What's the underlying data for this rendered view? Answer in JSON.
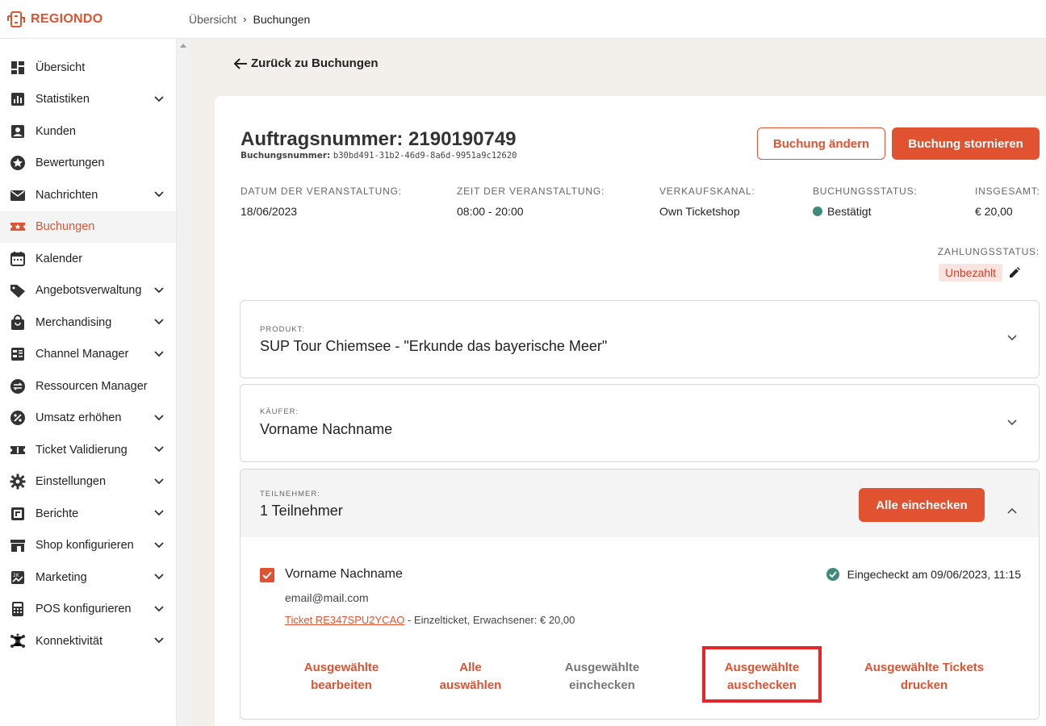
{
  "brand": {
    "name": "REGIONDO",
    "accent": "#e05230"
  },
  "breadcrumb": {
    "items": [
      "Übersicht",
      "Buchungen"
    ],
    "separator": "›"
  },
  "sidebar": {
    "items": [
      {
        "label": "Übersicht",
        "icon": "dashboard-icon",
        "expandable": false,
        "active": false
      },
      {
        "label": "Statistiken",
        "icon": "bar-chart-icon",
        "expandable": true,
        "active": false
      },
      {
        "label": "Kunden",
        "icon": "person-icon",
        "expandable": false,
        "active": false
      },
      {
        "label": "Bewertungen",
        "icon": "star-icon",
        "expandable": false,
        "active": false
      },
      {
        "label": "Nachrichten",
        "icon": "mail-icon",
        "expandable": true,
        "active": false
      },
      {
        "label": "Buchungen",
        "icon": "ticket-icon",
        "expandable": false,
        "active": true
      },
      {
        "label": "Kalender",
        "icon": "calendar-icon",
        "expandable": false,
        "active": false
      },
      {
        "label": "Angebotsverwaltung",
        "icon": "tag-icon",
        "expandable": true,
        "active": false
      },
      {
        "label": "Merchandising",
        "icon": "shopping-bag-icon",
        "expandable": true,
        "active": false
      },
      {
        "label": "Channel Manager",
        "icon": "channel-icon",
        "expandable": true,
        "active": false
      },
      {
        "label": "Ressourcen Manager",
        "icon": "swap-icon",
        "expandable": false,
        "active": false
      },
      {
        "label": "Umsatz erhöhen",
        "icon": "percent-icon",
        "expandable": true,
        "active": false
      },
      {
        "label": "Ticket Validierung",
        "icon": "ticket-validation-icon",
        "expandable": true,
        "active": false
      },
      {
        "label": "Einstellungen",
        "icon": "gear-icon",
        "expandable": true,
        "active": false
      },
      {
        "label": "Berichte",
        "icon": "report-icon",
        "expandable": true,
        "active": false
      },
      {
        "label": "Shop konfigurieren",
        "icon": "store-icon",
        "expandable": true,
        "active": false
      },
      {
        "label": "Marketing",
        "icon": "marketing-icon",
        "expandable": true,
        "active": false
      },
      {
        "label": "POS konfigurieren",
        "icon": "calculator-icon",
        "expandable": true,
        "active": false
      },
      {
        "label": "Konnektivität",
        "icon": "network-icon",
        "expandable": true,
        "active": false
      }
    ]
  },
  "main": {
    "back_link": "Zurück zu Buchungen",
    "order": {
      "title_prefix": "Auftragsnummer:",
      "order_number": "2190190749",
      "booking_label": "Buchungsnummer:",
      "booking_number": "b30bd491-31b2-46d9-8a6d-9951a9c12620"
    },
    "buttons": {
      "change": "Buchung ändern",
      "cancel": "Buchung stornieren"
    },
    "meta": {
      "event_date_label": "DATUM DER VERANSTALTUNG:",
      "event_date": "18/06/2023",
      "event_time_label": "ZEIT DER VERANSTALTUNG:",
      "event_time": "08:00 - 20:00",
      "channel_label": "VERKAUFSKANAL:",
      "channel": "Own Ticketshop",
      "status_label": "BUCHUNGSSTATUS:",
      "status": "Bestätigt",
      "total_label": "INSGESAMT:",
      "total": "€ 20,00"
    },
    "payment": {
      "label": "ZAHLUNGSSTATUS:",
      "status": "Unbezahlt"
    },
    "product": {
      "label": "PRODUKT:",
      "value": "SUP Tour Chiemsee - \"Erkunde das bayerische Meer\""
    },
    "buyer": {
      "label": "KÄUFER:",
      "value": "Vorname Nachname"
    },
    "participants": {
      "label": "TEILNEHMER:",
      "value": "1 Teilnehmer",
      "checkin_all": "Alle einchecken",
      "person": {
        "name": "Vorname Nachname",
        "email": "email@mail.com",
        "ticket_link": "Ticket RE347SPU2YCAO",
        "ticket_details": " - Einzelticket, Erwachsener: € 20,00",
        "checked_in": "Eingecheckt am 09/06/2023, 11:15",
        "selected": true
      },
      "actions": {
        "edit_line1": "Ausgewählte",
        "edit_line2": "bearbeiten",
        "all_line1": "Alle",
        "all_line2": "auswählen",
        "checkin_line1": "Ausgewählte",
        "checkin_line2": "einchecken",
        "checkout_line1": "Ausgewählte",
        "checkout_line2": "auschecken",
        "print_line1": "Ausgewählte Tickets",
        "print_line2": "drucken"
      }
    }
  }
}
